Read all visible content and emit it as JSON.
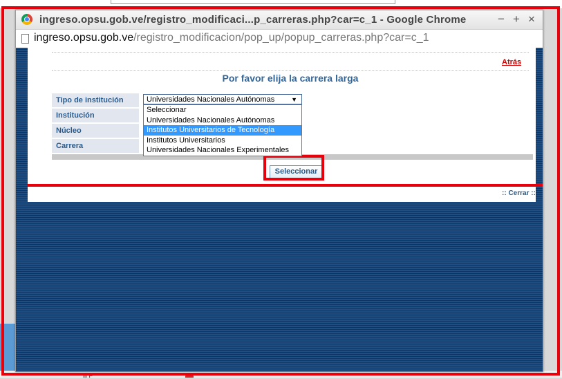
{
  "background": {
    "bottom_fragment": "ili F"
  },
  "window": {
    "title": "ingreso.opsu.gob.ve/registro_modificaci...p_carreras.php?car=c_1 - Google Chrome",
    "minimize_glyph": "−",
    "maximize_glyph": "+",
    "close_glyph": "×",
    "url_host": "ingreso.opsu.gob.ve",
    "url_path": "/registro_modificacion/pop_up/popup_carreras.php?car=c_1"
  },
  "page": {
    "back_link": "Atrás",
    "heading": "Por favor elija la carrera larga",
    "labels": {
      "tipo": "Tipo de institución",
      "institucion": "Institución",
      "nucleo": "Núcleo",
      "carrera": "Carrera"
    },
    "tipo_select": {
      "value": "Universidades Nacionales Autónomas",
      "options": [
        "Seleccionar",
        "Universidades Nacionales Autónomas",
        "Institutos Universitarios de Tecnología",
        "Institutos Universitarios",
        "Universidades Nacionales Experimentales"
      ],
      "highlighted_index": 2
    },
    "submit_label": "Seleccionar",
    "close_link": ":: Cerrar ::"
  },
  "colors": {
    "annotation": "#e8000a",
    "heading": "#336699",
    "highlight": "#3399ff"
  }
}
